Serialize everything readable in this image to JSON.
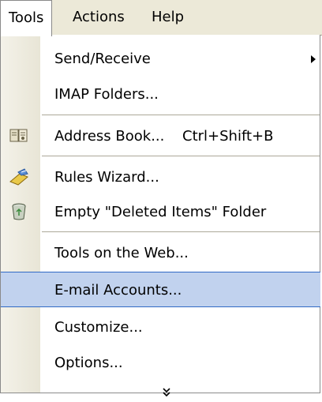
{
  "menubar": {
    "items": [
      {
        "label": "Tools",
        "state": "open"
      },
      {
        "label": "Actions"
      },
      {
        "label": "Help"
      }
    ]
  },
  "menu": {
    "items": [
      {
        "label": "Send/Receive",
        "has_submenu": true
      },
      {
        "label": "IMAP Folders..."
      },
      {
        "label": "Address Book...",
        "shortcut": "Ctrl+Shift+B",
        "icon": "address-book-icon"
      },
      {
        "label": "Rules Wizard...",
        "icon": "rules-wizard-icon"
      },
      {
        "label": "Empty \"Deleted Items\" Folder",
        "icon": "recycle-bin-icon"
      },
      {
        "label": "Tools on the Web..."
      },
      {
        "label": "E-mail Accounts...",
        "highlighted": true
      },
      {
        "label": "Customize..."
      },
      {
        "label": "Options..."
      }
    ],
    "expand_icon": "double-chevron-down-icon"
  },
  "colors": {
    "menubar_bg": "#ece9d8",
    "gutter": "#e8e5d6",
    "highlight_bg": "#c1d2ee",
    "highlight_border": "#316ac5"
  }
}
